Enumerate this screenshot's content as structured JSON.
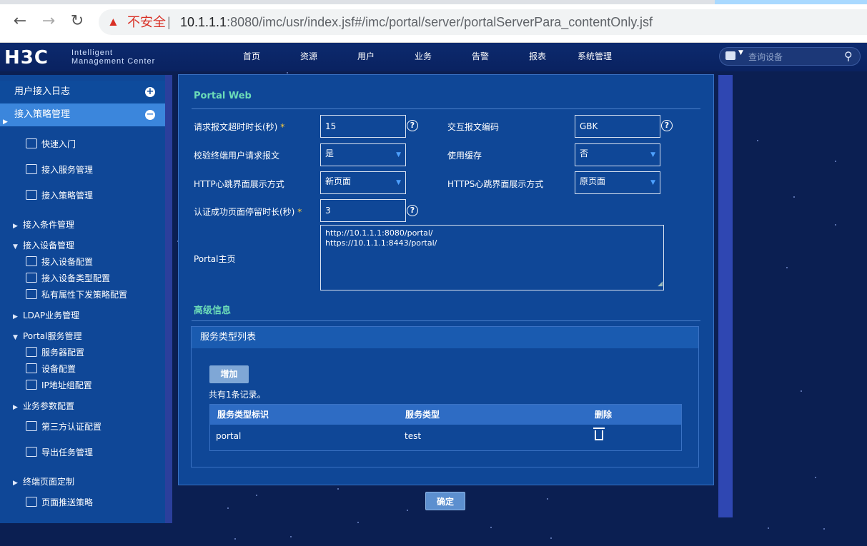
{
  "browser": {
    "back": "←",
    "forward": "→",
    "reload": "↻",
    "warning_icon": "▲",
    "security_text": "不安全",
    "separator": "|",
    "url_host": "10.1.1.1",
    "url_rest": ":8080/imc/usr/index.jsf#/imc/portal/server/portalServerPara_contentOnly.jsf"
  },
  "header": {
    "logo": "H3C",
    "logo_sub_line1": "Intelligent",
    "logo_sub_line2": "Management Center",
    "nav": [
      "首页",
      "资源",
      "用户",
      "业务",
      "告警",
      "报表",
      "系统管理"
    ],
    "search_placeholder": "查询设备"
  },
  "sidebar": {
    "head1": "用户接入日志",
    "head2": "接入策略管理",
    "items": [
      {
        "label": "快速入门",
        "icon": "quick-start-icon"
      },
      {
        "label": "接入服务管理",
        "icon": "service-icon"
      },
      {
        "label": "接入策略管理",
        "icon": "policy-icon"
      }
    ],
    "groups": {
      "cond": "接入条件管理",
      "device": "接入设备管理",
      "device_cfg": "接入设备配置",
      "device_type": "接入设备类型配置",
      "private_attr": "私有属性下发策略配置",
      "ldap": "LDAP业务管理",
      "portal": "Portal服务管理",
      "server_cfg": "服务器配置",
      "dev_cfg": "设备配置",
      "ip_group": "IP地址组配置",
      "biz_param": "业务参数配置",
      "third_auth": "第三方认证配置",
      "export_task": "导出任务管理",
      "terminal_page": "终端页面定制",
      "page_push": "页面推送策略"
    }
  },
  "form": {
    "section_portal": "Portal Web",
    "timeout_label": "请求报文超时时长(秒)",
    "timeout_value": "15",
    "encoding_label": "交互报文编码",
    "encoding_value": "GBK",
    "verify_label": "校验终端用户请求报文",
    "verify_value": "是",
    "cache_label": "使用缓存",
    "cache_value": "否",
    "http_hb_label": "HTTP心跳界面展示方式",
    "http_hb_value": "新页面",
    "https_hb_label": "HTTPS心跳界面展示方式",
    "https_hb_value": "原页面",
    "stay_label": "认证成功页面停留时长(秒)",
    "stay_value": "3",
    "home_label": "Portal主页",
    "home_line1": "http://10.1.1.1:8080/portal/",
    "home_line2": "https://10.1.1.1:8443/portal/",
    "required_mark": "*",
    "help_mark": "?"
  },
  "advanced": {
    "section_title": "高级信息",
    "list_title": "服务类型列表",
    "add_button": "增加",
    "record_count": "共有1条记录。",
    "columns": [
      "服务类型标识",
      "服务类型",
      "删除"
    ],
    "rows": [
      {
        "id": "portal",
        "type": "test"
      }
    ]
  },
  "footer": {
    "ok_button": "确定"
  }
}
